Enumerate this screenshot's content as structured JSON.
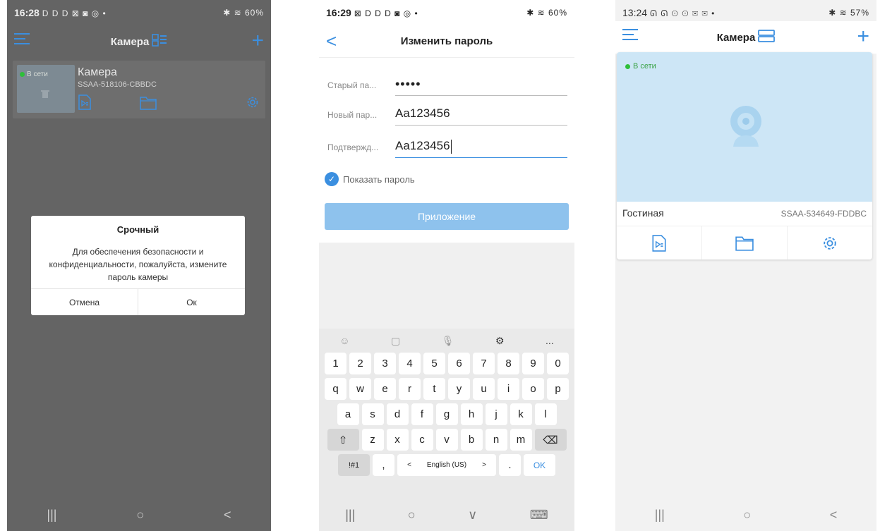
{
  "phone1": {
    "status": {
      "time": "16:28",
      "left_icons": "D D D ⊠ ◙ ◎ •",
      "right": "✱ ≋ 60%"
    },
    "header": {
      "title": "Камера"
    },
    "camera": {
      "status": "В сети",
      "name": "Камера",
      "id": "SSAA-518106-CBBDC"
    },
    "dialog": {
      "title": "Срочный",
      "message": "Для обеспечения безопасности и конфиденциальности, пожалуйста, измените пароль камеры",
      "cancel": "Отмена",
      "ok": "Ок"
    },
    "nav": {
      "recent": "|||",
      "home": "○",
      "back": "<"
    }
  },
  "phone2": {
    "status": {
      "time": "16:29",
      "left_icons": "⊠ D D D ◙ ◎ •",
      "right": "✱ ≋ 60%"
    },
    "header": {
      "back": "<",
      "title": "Изменить пароль"
    },
    "fields": {
      "old_label": "Старый па...",
      "old_value": "•••••",
      "new_label": "Новый пар...",
      "new_value": "Aa123456",
      "confirm_label": "Подтвержд...",
      "confirm_value": "Aa123456"
    },
    "show_password": "Показать пароль",
    "apply": "Приложение",
    "keyboard": {
      "numbers": [
        "1",
        "2",
        "3",
        "4",
        "5",
        "6",
        "7",
        "8",
        "9",
        "0"
      ],
      "row1": [
        "q",
        "w",
        "e",
        "r",
        "t",
        "y",
        "u",
        "i",
        "o",
        "p"
      ],
      "row2": [
        "a",
        "s",
        "d",
        "f",
        "g",
        "h",
        "j",
        "k",
        "l"
      ],
      "row3": [
        "z",
        "x",
        "c",
        "v",
        "b",
        "n",
        "m"
      ],
      "symbols": "!#1",
      "comma": ",",
      "space_left": "<",
      "space_label": "English (US)",
      "space_right": ">",
      "period": ".",
      "ok": "OK",
      "shift": "⇧",
      "backspace": "⌫",
      "more": "..."
    },
    "nav": {
      "recent": "|||",
      "home": "○",
      "down": "∨",
      "kb": "⌨"
    }
  },
  "phone3": {
    "status": {
      "time": "13:24",
      "left_icons": "ᘏ ᘏ ⊙ ⊙ ✉ ✉ •",
      "right": "✱ ≋ 57%"
    },
    "header": {
      "title": "Камера"
    },
    "camera": {
      "status": "В сети",
      "name": "Гостиная",
      "id": "SSAA-534649-FDDBC"
    },
    "nav": {
      "recent": "|||",
      "home": "○",
      "back": "<"
    }
  }
}
